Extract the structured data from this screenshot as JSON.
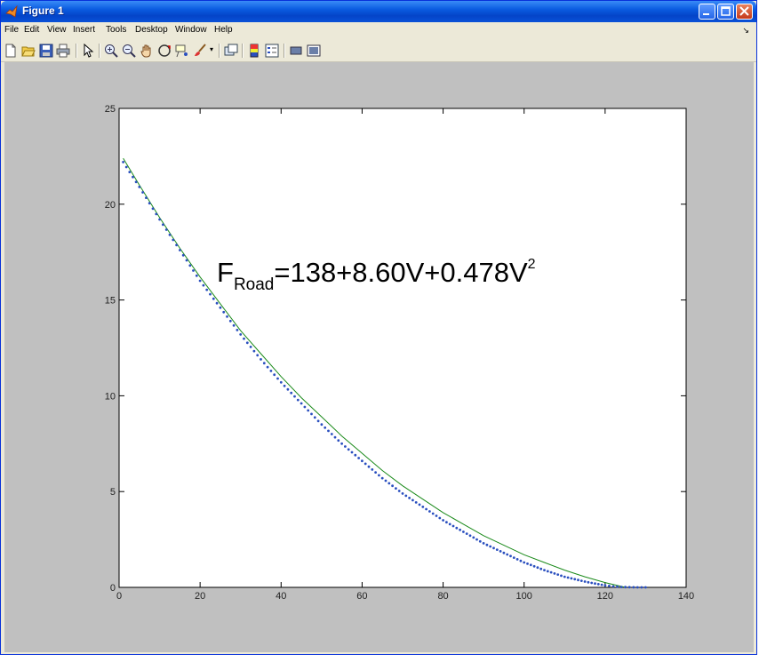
{
  "window": {
    "title": "Figure 1"
  },
  "menu": [
    "File",
    "Edit",
    "View",
    "Insert",
    "Tools",
    "Desktop",
    "Window",
    "Help"
  ],
  "toolbar": {
    "buttons": [
      "new-figure-icon",
      "open-file-icon",
      "save-icon",
      "print-icon",
      "edit-plot-arrow-icon",
      "zoom-in-icon",
      "zoom-out-icon",
      "pan-hand-icon",
      "rotate-3d-icon",
      "data-cursor-icon",
      "brush-icon",
      "link-plot-icon",
      "insert-colorbar-icon",
      "insert-legend-icon",
      "hide-plot-tools-icon",
      "show-plot-tools-icon"
    ]
  },
  "annotation": {
    "main": "F",
    "subscript": "Road",
    "rest": "=138+8.60V+0.478V",
    "superscript": "2"
  },
  "colors": {
    "dotted_series": "#2a4fbf",
    "fit_line": "#1a8a1a",
    "figure_background": "#c0c0c0"
  },
  "chart_data": {
    "type": "line",
    "title": "",
    "xlabel": "",
    "ylabel": "",
    "xlim": [
      0,
      140
    ],
    "ylim": [
      0,
      25
    ],
    "xticks": [
      0,
      20,
      40,
      60,
      80,
      100,
      120,
      140
    ],
    "yticks": [
      0,
      5,
      10,
      15,
      20,
      25
    ],
    "grid": false,
    "series": [
      {
        "style": "dotted",
        "color": "#2a4fbf",
        "x": [
          1,
          5,
          10,
          15,
          20,
          25,
          30,
          35,
          40,
          45,
          50,
          55,
          60,
          65,
          70,
          75,
          80,
          85,
          90,
          95,
          100,
          105,
          110,
          115,
          120,
          122,
          124,
          126,
          128,
          130
        ],
        "y": [
          22.2,
          20.9,
          19.2,
          17.6,
          16.0,
          14.6,
          13.2,
          11.9,
          10.7,
          9.6,
          8.5,
          7.5,
          6.6,
          5.7,
          4.9,
          4.2,
          3.5,
          2.9,
          2.3,
          1.8,
          1.3,
          0.9,
          0.55,
          0.3,
          0.1,
          0.05,
          0.02,
          0.01,
          0.0,
          0.0
        ]
      },
      {
        "style": "solid",
        "color": "#1a8a1a",
        "x": [
          1,
          5,
          10,
          15,
          20,
          25,
          30,
          35,
          40,
          45,
          50,
          55,
          60,
          65,
          70,
          75,
          80,
          85,
          90,
          95,
          100,
          105,
          110,
          115,
          120,
          125
        ],
        "y": [
          22.4,
          21.0,
          19.3,
          17.7,
          16.2,
          14.8,
          13.4,
          12.2,
          11.0,
          9.9,
          8.9,
          7.9,
          7.0,
          6.1,
          5.3,
          4.6,
          3.9,
          3.3,
          2.7,
          2.2,
          1.7,
          1.3,
          0.9,
          0.55,
          0.25,
          0.0
        ]
      }
    ]
  }
}
